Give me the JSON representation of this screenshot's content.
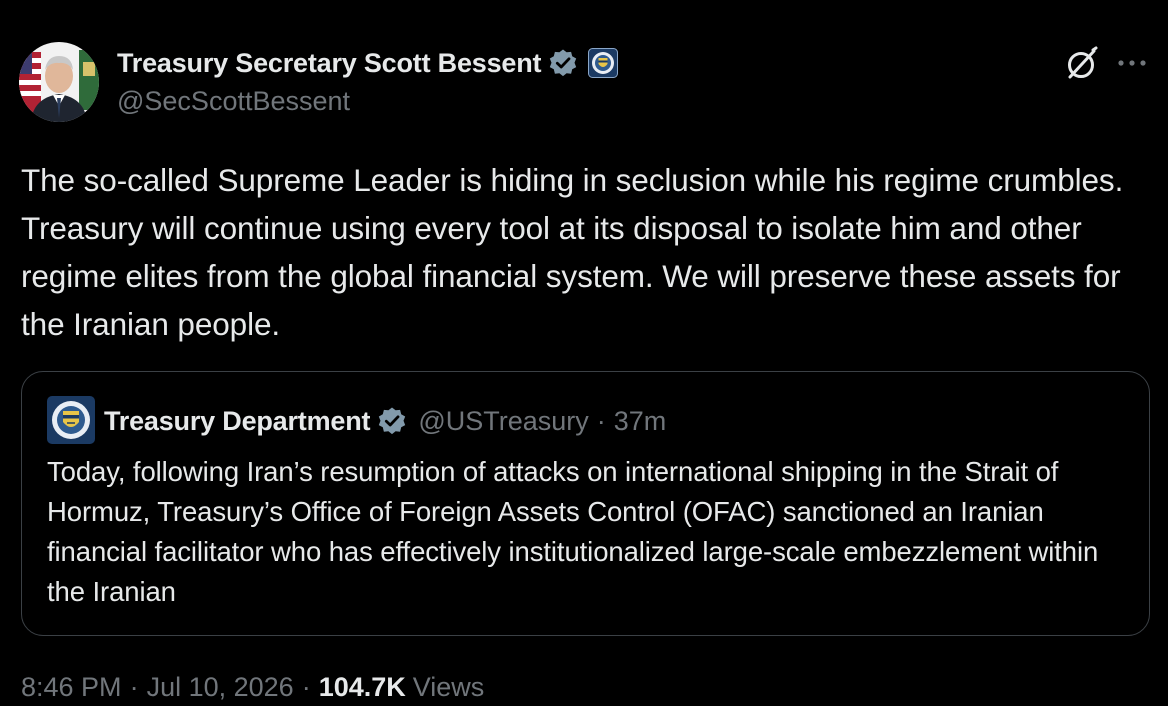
{
  "author": {
    "display_name": "Treasury Secretary Scott Bessent",
    "handle": "@SecScottBessent",
    "verified_badge_icon": "verified-badge-icon",
    "affiliation_icon": "treasury-seal-icon",
    "avatar": "avatar-photo"
  },
  "actions": {
    "grok_icon": "grok-icon",
    "more_icon": "more-icon"
  },
  "tweet": {
    "text": "The so-called Supreme Leader is hiding in seclusion while his regime crumbles. Treasury will continue using every tool at its disposal to isolate him and other regime elites from the global financial system. We will preserve these assets for the Iranian people."
  },
  "quote": {
    "display_name": "Treasury Department",
    "handle": "@USTreasury",
    "separator": "·",
    "time": "37m",
    "text": "Today, following Iran’s resumption of attacks on international shipping in the Strait of Hormuz, Treasury’s Office of Foreign Assets Control (OFAC) sanctioned an Iranian financial facilitator who has effectively institutionalized large-scale embezzlement within the Iranian"
  },
  "meta": {
    "time": "8:46 PM",
    "separator": "·",
    "date": "Jul 10, 2026",
    "views_count": "104.7K",
    "views_label": "Views"
  },
  "colors": {
    "background": "#000000",
    "text_primary": "#e7e9ea",
    "text_secondary": "#71767b",
    "border": "#3b4045",
    "verified_badge": "#829aab"
  }
}
